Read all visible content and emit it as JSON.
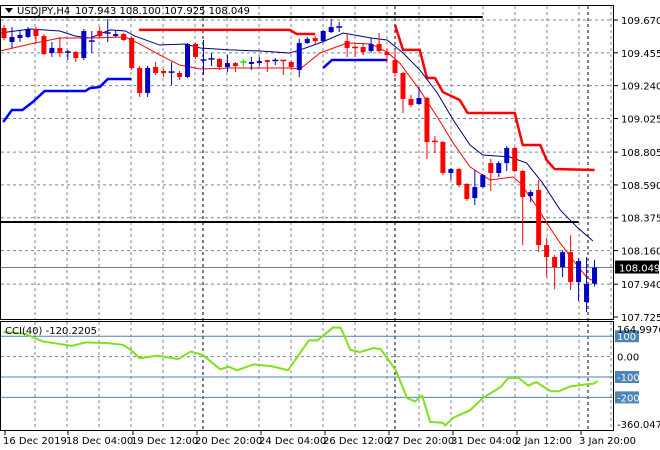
{
  "header": {
    "symbol_tf": "USDJPY,H4",
    "ohlc": "107.943 108.100 107.925 108.049"
  },
  "colors": {
    "bull": "#0000c8",
    "bear": "#ff0000",
    "doji": "#00e000",
    "cci": "#80e020",
    "level": "#4a86b8",
    "ma_upper": "#000080",
    "ma_lower": "#ff0000",
    "stop_upper": "#ff0000",
    "stop_lower": "#0000ff",
    "grid": "#7a8898"
  },
  "price_axis": {
    "labels": [
      "109.670",
      "109.455",
      "109.240",
      "109.025",
      "108.805",
      "108.590",
      "108.375",
      "108.160",
      "107.940",
      "107.725"
    ],
    "current": "108.049",
    "current_value": 108.049
  },
  "cci_axis": {
    "title": "CCI(40) -120.2205",
    "max_label": "164.9976",
    "min_label": "-360.0478",
    "levels": [
      "100",
      "0.00",
      "-100",
      "-200"
    ]
  },
  "time_axis": [
    "16 Dec 2019",
    "18 Dec 04:00",
    "19 Dec 12:00",
    "20 Dec 20:00",
    "24 Dec 04:00",
    "26 Dec 12:00",
    "27 Dec 20:00",
    "31 Dec 04:00",
    "2 Jan 12:00",
    "3 Jan 20:00"
  ],
  "chart_data": {
    "type": "candlestick",
    "symbol": "USDJPY",
    "timeframe": "H4",
    "ylim": [
      107.725,
      109.67
    ],
    "candles_ohlc": [
      [
        109.618,
        109.637,
        109.539,
        109.552
      ],
      [
        109.526,
        109.624,
        109.487,
        109.559
      ],
      [
        109.552,
        109.605,
        109.526,
        109.572
      ],
      [
        109.559,
        109.624,
        109.552,
        109.611
      ],
      [
        109.611,
        109.624,
        109.519,
        109.565
      ],
      [
        109.565,
        109.578,
        109.441,
        109.447
      ],
      [
        109.454,
        109.526,
        109.428,
        109.487
      ],
      [
        109.487,
        109.559,
        109.428,
        109.454
      ],
      [
        109.454,
        109.474,
        109.408,
        109.46
      ],
      [
        109.46,
        109.467,
        109.395,
        109.421
      ],
      [
        109.421,
        109.611,
        109.408,
        109.598
      ],
      [
        109.526,
        109.598,
        109.454,
        109.532
      ],
      [
        109.598,
        109.624,
        109.559,
        109.565
      ],
      [
        109.578,
        109.677,
        109.526,
        109.585
      ],
      [
        109.565,
        109.605,
        109.559,
        109.578
      ],
      [
        109.578,
        109.585,
        109.532,
        109.539
      ],
      [
        109.552,
        109.559,
        109.343,
        109.356
      ],
      [
        109.356,
        109.369,
        109.166,
        109.192
      ],
      [
        109.192,
        109.369,
        109.166,
        109.356
      ],
      [
        109.362,
        109.395,
        109.31,
        109.323
      ],
      [
        109.336,
        109.349,
        109.297,
        109.323
      ],
      [
        109.323,
        109.395,
        109.244,
        109.329
      ],
      [
        109.323,
        109.336,
        109.277,
        109.297
      ],
      [
        109.297,
        109.519,
        109.29,
        109.513
      ],
      [
        109.513,
        109.519,
        109.415,
        109.428
      ],
      [
        109.401,
        109.539,
        109.31,
        109.408
      ],
      [
        109.408,
        109.454,
        109.369,
        109.415
      ],
      [
        109.415,
        109.421,
        109.343,
        109.362
      ],
      [
        109.362,
        109.441,
        109.329,
        109.388
      ],
      [
        109.388,
        109.395,
        109.329,
        109.369
      ],
      [
        109.395,
        109.415,
        109.362,
        109.395
      ],
      [
        109.382,
        109.428,
        109.343,
        109.395
      ],
      [
        109.388,
        109.428,
        109.369,
        109.401
      ],
      [
        109.408,
        109.408,
        109.329,
        109.395
      ],
      [
        109.401,
        109.421,
        109.375,
        109.405
      ],
      [
        109.405,
        109.408,
        109.31,
        109.401
      ],
      [
        109.395,
        109.401,
        109.343,
        109.362
      ],
      [
        109.343,
        109.546,
        109.297,
        109.519
      ],
      [
        109.519,
        109.559,
        109.513,
        109.546
      ],
      [
        109.552,
        109.565,
        109.513,
        109.532
      ],
      [
        109.532,
        109.605,
        109.526,
        109.598
      ],
      [
        109.591,
        109.677,
        109.585,
        109.624
      ],
      [
        109.62,
        109.657,
        109.591,
        109.624
      ],
      [
        109.532,
        109.585,
        109.428,
        109.487
      ],
      [
        109.49,
        109.506,
        109.428,
        109.487
      ],
      [
        109.493,
        109.519,
        109.441,
        109.46
      ],
      [
        109.467,
        109.552,
        109.454,
        109.513
      ],
      [
        109.513,
        109.585,
        109.454,
        109.467
      ],
      [
        109.46,
        109.487,
        109.388,
        109.441
      ],
      [
        109.408,
        109.474,
        109.297,
        109.323
      ],
      [
        109.323,
        109.329,
        109.061,
        109.153
      ],
      [
        109.153,
        109.179,
        109.1,
        109.113
      ],
      [
        109.12,
        109.231,
        109.113,
        109.159
      ],
      [
        109.159,
        109.166,
        108.76,
        108.871
      ],
      [
        108.875,
        108.91,
        108.799,
        108.871
      ],
      [
        108.871,
        108.878,
        108.655,
        108.668
      ],
      [
        108.668,
        108.701,
        108.622,
        108.694
      ],
      [
        108.694,
        108.701,
        108.576,
        108.589
      ],
      [
        108.596,
        108.602,
        108.485,
        108.498
      ],
      [
        108.504,
        108.688,
        108.458,
        108.576
      ],
      [
        108.576,
        108.661,
        108.57,
        108.655
      ],
      [
        108.733,
        108.76,
        108.55,
        108.668
      ],
      [
        108.668,
        108.746,
        108.642,
        108.733
      ],
      [
        108.733,
        108.845,
        108.681,
        108.832
      ],
      [
        108.832,
        108.838,
        108.675,
        108.681
      ],
      [
        108.681,
        108.688,
        108.196,
        108.511
      ],
      [
        108.517,
        108.557,
        108.478,
        108.543
      ],
      [
        108.557,
        108.622,
        108.15,
        108.196
      ],
      [
        108.196,
        108.242,
        107.987,
        108.118
      ],
      [
        108.118,
        108.131,
        107.908,
        108.052
      ],
      [
        108.052,
        108.163,
        107.987,
        108.15
      ],
      [
        108.15,
        108.261,
        107.902,
        107.954
      ],
      [
        107.954,
        108.111,
        107.83,
        108.091
      ],
      [
        107.823,
        108.118,
        107.757,
        107.941
      ],
      [
        107.943,
        108.1,
        107.925,
        108.049
      ]
    ],
    "ma_upper": [
      [
        -0.5,
        109.585
      ],
      [
        3.3,
        109.611
      ],
      [
        7,
        109.598
      ],
      [
        8.9,
        109.565
      ],
      [
        10.8,
        109.552
      ],
      [
        13.3,
        109.605
      ],
      [
        15.2,
        109.598
      ],
      [
        16.4,
        109.565
      ],
      [
        19.5,
        109.506
      ],
      [
        22.7,
        109.513
      ],
      [
        24.6,
        109.487
      ],
      [
        28.3,
        109.474
      ],
      [
        32.1,
        109.467
      ],
      [
        35.8,
        109.454
      ],
      [
        37.1,
        109.474
      ],
      [
        39.9,
        109.526
      ],
      [
        42.5,
        109.585
      ],
      [
        46,
        109.552
      ],
      [
        48,
        109.539
      ],
      [
        50,
        109.454
      ],
      [
        52.1,
        109.343
      ],
      [
        54.3,
        109.192
      ],
      [
        56.3,
        109.015
      ],
      [
        58.4,
        108.851
      ],
      [
        60,
        108.786
      ],
      [
        63.4,
        108.773
      ],
      [
        65.5,
        108.733
      ],
      [
        67.5,
        108.602
      ],
      [
        69.7,
        108.426
      ],
      [
        71.8,
        108.314
      ],
      [
        73.8,
        108.223
      ]
    ],
    "ma_lower": [
      [
        -0.5,
        109.467
      ],
      [
        3.3,
        109.513
      ],
      [
        7,
        109.552
      ],
      [
        10.8,
        109.552
      ],
      [
        15.2,
        109.559
      ],
      [
        17,
        109.513
      ],
      [
        19.5,
        109.441
      ],
      [
        22,
        109.375
      ],
      [
        24.6,
        109.349
      ],
      [
        28.3,
        109.356
      ],
      [
        32.1,
        109.356
      ],
      [
        35.8,
        109.356
      ],
      [
        37.1,
        109.349
      ],
      [
        39.6,
        109.454
      ],
      [
        43,
        109.519
      ],
      [
        46,
        109.513
      ],
      [
        48,
        109.46
      ],
      [
        49.6,
        109.388
      ],
      [
        52.1,
        109.211
      ],
      [
        54.3,
        109.035
      ],
      [
        56.3,
        108.864
      ],
      [
        58.4,
        108.708
      ],
      [
        60.9,
        108.622
      ],
      [
        63.8,
        108.642
      ],
      [
        64.7,
        108.602
      ],
      [
        66.8,
        108.445
      ],
      [
        68.2,
        108.327
      ],
      [
        69.7,
        108.209
      ],
      [
        71.3,
        108.098
      ],
      [
        73.1,
        107.98
      ],
      [
        74.3,
        107.954
      ]
    ],
    "stop_upper": [
      [
        [
          16.9,
          109.605
        ],
        [
          35.8,
          109.605
        ],
        [
          36.7,
          109.578
        ],
        [
          39,
          109.578
        ]
      ],
      [
        [
          49,
          109.637
        ],
        [
          50,
          109.474
        ],
        [
          52.1,
          109.474
        ],
        [
          53,
          109.29
        ],
        [
          54,
          109.29
        ],
        [
          55,
          109.198
        ],
        [
          57.1,
          109.146
        ],
        [
          58.1,
          109.061
        ],
        [
          64,
          109.061
        ],
        [
          65,
          108.851
        ],
        [
          67.2,
          108.851
        ],
        [
          68,
          108.753
        ],
        [
          69,
          108.694
        ],
        [
          74,
          108.688
        ]
      ]
    ],
    "stop_lower": [
      [
        [
          -0.1,
          109.002
        ],
        [
          1,
          109.081
        ],
        [
          2.3,
          109.081
        ],
        [
          3.6,
          109.133
        ],
        [
          5.1,
          109.205
        ],
        [
          10.2,
          109.205
        ],
        [
          10.8,
          109.225
        ],
        [
          12,
          109.231
        ],
        [
          13,
          109.284
        ],
        [
          16,
          109.284
        ]
      ],
      [
        [
          40,
          109.356
        ],
        [
          41.1,
          109.408
        ],
        [
          48,
          109.408
        ]
      ]
    ],
    "hlines": [
      {
        "price": 109.69,
        "to_bar": 60
      },
      {
        "price": 108.347,
        "to_bar": 72
      }
    ],
    "cci": {
      "period": 40,
      "last": -120.2205,
      "ylim": [
        -360.0478,
        164.9976
      ],
      "levels": [
        100,
        0,
        -100,
        -200
      ],
      "points": [
        [
          -0.1,
          120
        ],
        [
          2.6,
          113
        ],
        [
          4.8,
          75
        ],
        [
          8.5,
          53
        ],
        [
          10.2,
          70
        ],
        [
          12.8,
          67
        ],
        [
          14.9,
          58
        ],
        [
          15.9,
          33
        ],
        [
          17,
          -8
        ],
        [
          19.2,
          5
        ],
        [
          21.8,
          -12
        ],
        [
          23.4,
          25
        ],
        [
          24.9,
          8
        ],
        [
          27.1,
          -62
        ],
        [
          28.2,
          -50
        ],
        [
          29.2,
          -67
        ],
        [
          31.3,
          -38
        ],
        [
          33.5,
          -47
        ],
        [
          35.6,
          -67
        ],
        [
          38.2,
          80
        ],
        [
          39.3,
          80
        ],
        [
          41.2,
          142
        ],
        [
          42.2,
          142
        ],
        [
          43.4,
          33
        ],
        [
          44.6,
          22
        ],
        [
          46.3,
          42
        ],
        [
          47.2,
          37
        ],
        [
          49.1,
          -67
        ],
        [
          50.5,
          -203
        ],
        [
          51.5,
          -220
        ],
        [
          52.4,
          -192
        ],
        [
          53.4,
          -320
        ],
        [
          55,
          -325
        ],
        [
          55.3,
          -337
        ],
        [
          56.3,
          -300
        ],
        [
          58.4,
          -263
        ],
        [
          60,
          -203
        ],
        [
          62.2,
          -150
        ],
        [
          63.2,
          -105
        ],
        [
          64.5,
          -105
        ],
        [
          65.7,
          -142
        ],
        [
          66.7,
          -125
        ],
        [
          68.5,
          -170
        ],
        [
          69.5,
          -170
        ],
        [
          70.9,
          -147
        ],
        [
          72.8,
          -137
        ],
        [
          73.8,
          -133
        ],
        [
          74.4,
          -120.2
        ]
      ]
    }
  }
}
